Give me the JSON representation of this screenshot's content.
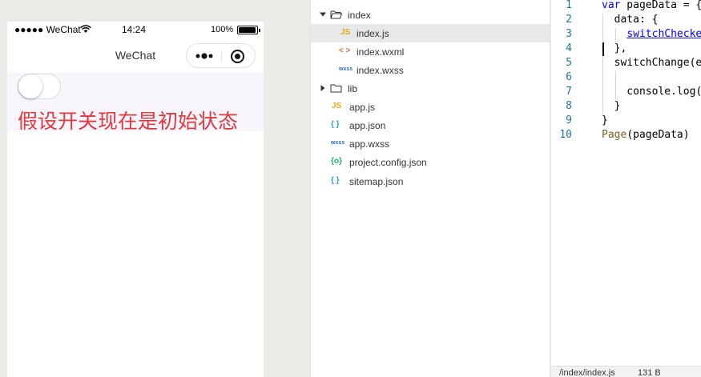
{
  "simulator": {
    "status_bar": {
      "carrier": "●●●●● WeChat",
      "time": "14:24",
      "battery_pct": "100%"
    },
    "nav_bar": {
      "title": "WeChat"
    },
    "page": {
      "switch_checked": false,
      "hint_text": "假设开关现在是初始状态"
    },
    "colors": {
      "hint_text": "#e0393e",
      "highlight_bg": "#f8f5fd"
    }
  },
  "file_tree": {
    "items": [
      {
        "label": "index",
        "kind": "folder",
        "expanded": true,
        "depth": 0
      },
      {
        "label": "index.js",
        "kind": "js",
        "type_badge": "JS",
        "depth": 1,
        "selected": true
      },
      {
        "label": "index.wxml",
        "kind": "wxml",
        "type_badge": "< >",
        "depth": 1
      },
      {
        "label": "index.wxss",
        "kind": "wxss",
        "type_badge": "wxss",
        "depth": 1
      },
      {
        "label": "lib",
        "kind": "folder",
        "expanded": false,
        "depth": 0
      },
      {
        "label": "app.js",
        "kind": "js",
        "type_badge": "JS",
        "depth": 0
      },
      {
        "label": "app.json",
        "kind": "json",
        "type_badge": "{ }",
        "depth": 0
      },
      {
        "label": "app.wxss",
        "kind": "wxss",
        "type_badge": "wxss",
        "depth": 0
      },
      {
        "label": "project.config.json",
        "kind": "config",
        "type_badge": "{o}",
        "depth": 0
      },
      {
        "label": "sitemap.json",
        "kind": "json",
        "type_badge": "{ }",
        "depth": 0
      }
    ]
  },
  "editor": {
    "line_numbers": [
      "1",
      "2",
      "3",
      "4",
      "5",
      "6",
      "7",
      "8",
      "9",
      "10"
    ],
    "lines": [
      [
        {
          "t": "var",
          "c": "kw"
        },
        {
          "t": " pageData = {",
          "c": ""
        }
      ],
      [
        {
          "t": "  data: {",
          "c": ""
        }
      ],
      [
        {
          "t": "    ",
          "c": ""
        },
        {
          "t": "switchChecke",
          "c": "link"
        }
      ],
      [
        {
          "t": "  },",
          "c": ""
        }
      ],
      [
        {
          "t": "  switchChange(e",
          "c": ""
        }
      ],
      [
        {
          "t": "",
          "c": ""
        }
      ],
      [
        {
          "t": "    console.log(",
          "c": ""
        }
      ],
      [
        {
          "t": "  }",
          "c": ""
        }
      ],
      [
        {
          "t": "}",
          "c": ""
        }
      ],
      [
        {
          "t": "Page",
          "c": "fn"
        },
        {
          "t": "(pageData)",
          "c": ""
        }
      ]
    ],
    "status": {
      "path": "/index/index.js",
      "size": "131 B"
    }
  }
}
